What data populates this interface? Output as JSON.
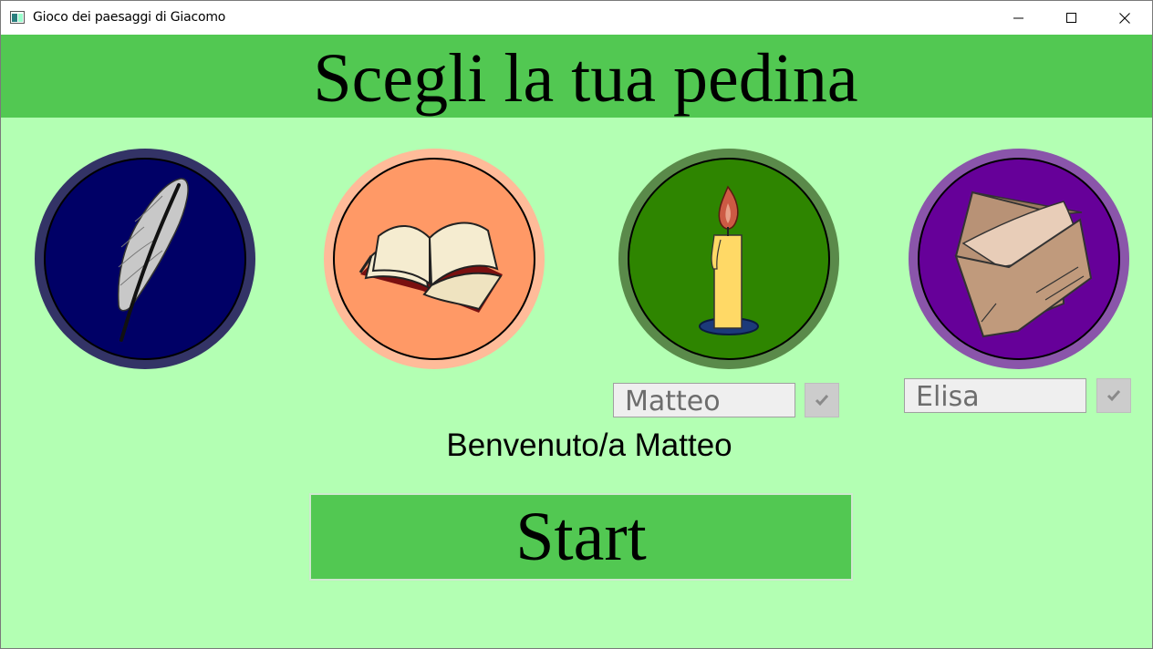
{
  "window": {
    "title": "Gioco dei paesaggi di Giacomo",
    "controls": [
      "minimize",
      "maximize",
      "close"
    ]
  },
  "header": {
    "title": "Scegli la tua pedina",
    "color": "#52c852"
  },
  "tokens": [
    {
      "name": "feather",
      "icon": "feather-icon",
      "ring_color": "#333366",
      "fill_color": "#000066"
    },
    {
      "name": "book",
      "icon": "open-book-icon",
      "ring_color": "#ffbb99",
      "fill_color": "#ff9966"
    },
    {
      "name": "candle",
      "icon": "candle-icon",
      "ring_color": "#5a8a4a",
      "fill_color": "#2e8500"
    },
    {
      "name": "envelope",
      "icon": "envelope-icon",
      "ring_color": "#8a55aa",
      "fill_color": "#660099"
    }
  ],
  "players": [
    {
      "token": "candle",
      "name_value": "Matteo"
    },
    {
      "token": "envelope",
      "name_value": "Elisa"
    }
  ],
  "welcome_text": "Benvenuto/a Matteo",
  "start_button": {
    "label": "Start"
  },
  "colors": {
    "background": "#b3ffb3",
    "accent": "#52c852"
  }
}
